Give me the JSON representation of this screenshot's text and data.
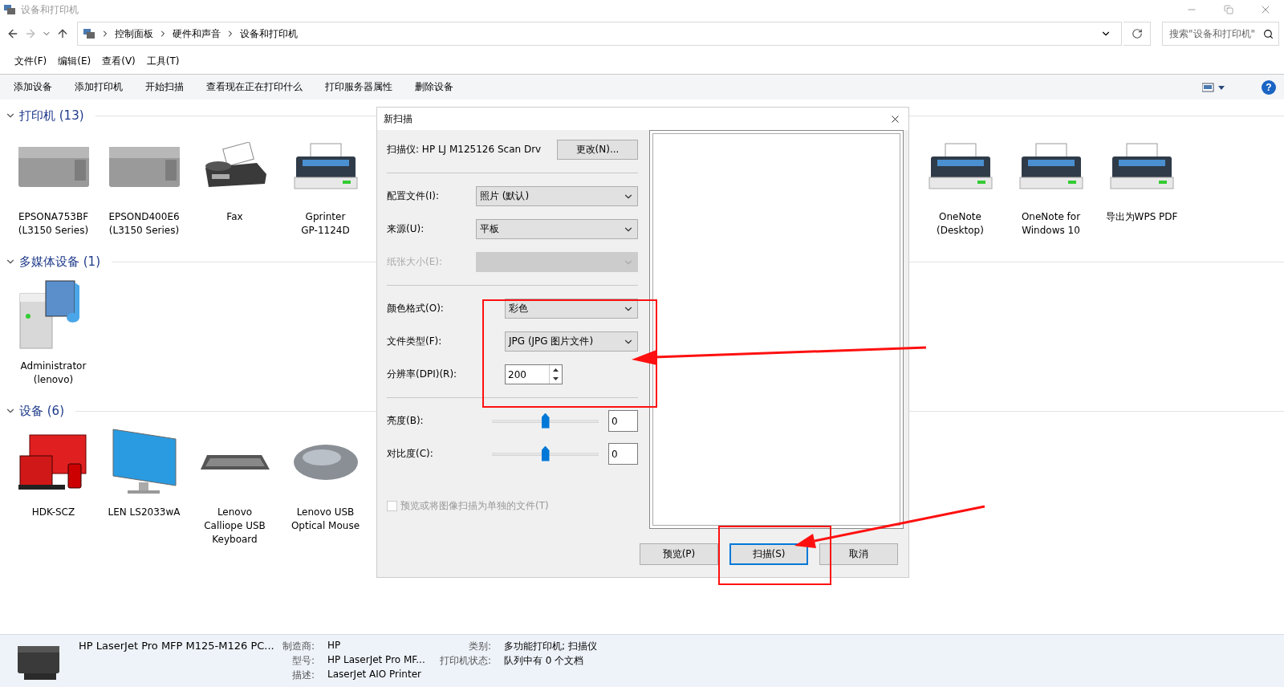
{
  "window": {
    "title": "设备和打印机"
  },
  "address": {
    "path": [
      "控制面板",
      "硬件和声音",
      "设备和打印机"
    ]
  },
  "search": {
    "placeholder": "搜索\"设备和打印机\""
  },
  "menu": [
    "文件(F)",
    "编辑(E)",
    "查看(V)",
    "工具(T)"
  ],
  "toolbar": {
    "items": [
      "添加设备",
      "添加打印机",
      "开始扫描",
      "查看现在正在打印什么",
      "打印服务器属性",
      "删除设备"
    ],
    "help": "?"
  },
  "groups": [
    {
      "title": "打印机 (13)",
      "expanded": true,
      "items": [
        {
          "kind": "inkjet",
          "lines": [
            "EPSONA753BF",
            "(L3150 Series)"
          ]
        },
        {
          "kind": "inkjet",
          "lines": [
            "EPSOND400E6",
            "(L3150 Series)"
          ]
        },
        {
          "kind": "fax",
          "lines": [
            "Fax"
          ]
        },
        {
          "kind": "printer",
          "lines": [
            "Gprinter",
            "GP-1124D"
          ]
        }
      ],
      "items_right_of_dialog": [
        {
          "kind": "printer",
          "lines": [
            "OneNote",
            "(Desktop)"
          ]
        },
        {
          "kind": "printer",
          "lines": [
            "OneNote for",
            "Windows 10"
          ]
        },
        {
          "kind": "printer",
          "lines": [
            "导出为WPS PDF"
          ]
        }
      ]
    },
    {
      "title": "多媒体设备 (1)",
      "expanded": true,
      "items": [
        {
          "kind": "media",
          "lines": [
            "Administrator",
            "(lenovo)"
          ]
        }
      ]
    },
    {
      "title": "设备 (6)",
      "expanded": true,
      "items": [
        {
          "kind": "laptop",
          "lines": [
            "HDK-SCZ"
          ]
        },
        {
          "kind": "monitor",
          "lines": [
            "LEN LS2033wA"
          ]
        },
        {
          "kind": "keyboard",
          "lines": [
            "Lenovo",
            "Calliope USB",
            "Keyboard"
          ]
        },
        {
          "kind": "mouse",
          "lines": [
            "Lenovo USB",
            "Optical Mouse"
          ]
        }
      ]
    }
  ],
  "dialog": {
    "title": "新扫描",
    "scanner": {
      "label": "扫描仪: HP LJ M125126 Scan Drv",
      "button": "更改(N)..."
    },
    "sections": [
      {
        "fields": [
          {
            "kind": "select",
            "label": "配置文件(I):",
            "value": "照片 (默认)",
            "disabled": false
          },
          {
            "kind": "select",
            "label": "来源(U):",
            "value": "平板",
            "disabled": false
          },
          {
            "kind": "select",
            "label": "纸张大小(E):",
            "disabled": true
          }
        ]
      },
      {
        "fields": [
          {
            "kind": "select",
            "label": "颜色格式(O):",
            "value": "彩色",
            "disabled": false
          },
          {
            "kind": "select",
            "label": "文件类型(F):",
            "value": "JPG (JPG 图片文件)",
            "disabled": false
          },
          {
            "kind": "spin",
            "label": "分辨率(DPI)(R):",
            "value": "200",
            "disabled": false
          }
        ]
      },
      {
        "fields": [
          {
            "kind": "slider",
            "label": "亮度(B):",
            "level": 0.5,
            "value": "0",
            "disabled": false
          },
          {
            "kind": "slider",
            "label": "对比度(C):",
            "level": 0.5,
            "value": "0",
            "disabled": false
          }
        ]
      }
    ],
    "checkbox": {
      "label": "预览或将图像扫描为单独的文件(T)",
      "checked": false,
      "disabled": true
    },
    "buttons": [
      {
        "label": "预览(P)",
        "default": false
      },
      {
        "label": "扫描(S)",
        "default": true
      },
      {
        "label": "取消",
        "default": false
      }
    ]
  },
  "status_bar": {
    "name": "HP LaserJet Pro MFP M125-M126 PC...",
    "properties": [
      {
        "label": "制造商:",
        "value": "HP"
      },
      {
        "label": "类别:",
        "value": "多功能打印机; 扫描仪"
      },
      {
        "label": "型号:",
        "value": "HP LaserJet Pro MF..."
      },
      {
        "label": "打印机状态:",
        "value": "队列中有 0 个文档"
      },
      {
        "label": "描述:",
        "value": "LaserJet AIO Printer"
      }
    ]
  }
}
